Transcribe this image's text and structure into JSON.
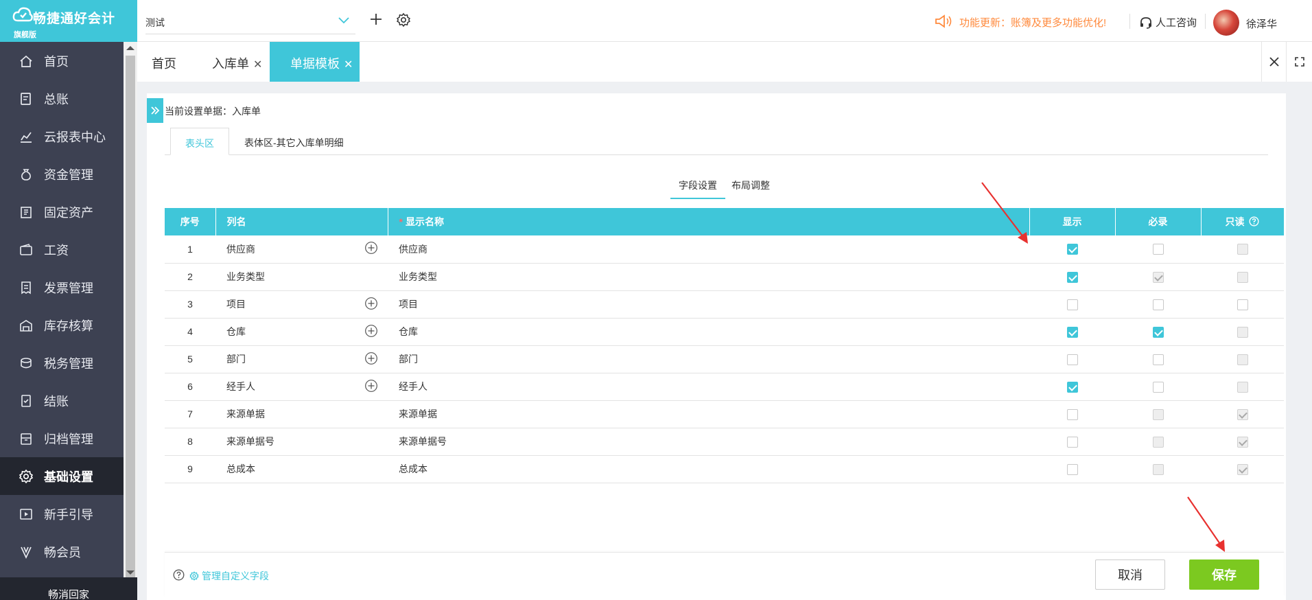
{
  "app": {
    "brand": "畅捷通好会计",
    "edition": "旗舰版"
  },
  "sidebar": {
    "items": [
      {
        "label": "首页",
        "icon": "home-icon"
      },
      {
        "label": "总账",
        "icon": "ledger-icon"
      },
      {
        "label": "云报表中心",
        "icon": "chart-icon"
      },
      {
        "label": "资金管理",
        "icon": "money-bag-icon"
      },
      {
        "label": "固定资产",
        "icon": "asset-icon"
      },
      {
        "label": "工资",
        "icon": "wallet-icon"
      },
      {
        "label": "发票管理",
        "icon": "invoice-icon"
      },
      {
        "label": "库存核算",
        "icon": "warehouse-icon"
      },
      {
        "label": "税务管理",
        "icon": "tax-icon"
      },
      {
        "label": "结账",
        "icon": "checkout-icon"
      },
      {
        "label": "归档管理",
        "icon": "archive-icon"
      },
      {
        "label": "基础设置",
        "icon": "gear-icon",
        "active": true
      },
      {
        "label": "新手引导",
        "icon": "guide-icon"
      },
      {
        "label": "畅会员",
        "icon": "vip-icon"
      }
    ],
    "bottom_label": "畅消回家"
  },
  "topbar": {
    "account_name": "测试",
    "notice": "功能更新：账簿及更多功能优化!",
    "consult": "人工咨询",
    "username": "徐泽华"
  },
  "tabs": [
    {
      "label": "首页",
      "closable": false
    },
    {
      "label": "入库单",
      "closable": true
    },
    {
      "label": "单据模板",
      "closable": true,
      "active": true
    }
  ],
  "panel": {
    "current_doc": "当前设置单据：入库单",
    "sub_tabs": [
      "表头区",
      "表体区-其它入库单明细"
    ],
    "setting_tabs": [
      "字段设置",
      "布局调整"
    ]
  },
  "table": {
    "headers": {
      "seq": "序号",
      "col": "列名",
      "display_name": "显示名称",
      "show": "显示",
      "required": "必录",
      "readonly": "只读"
    },
    "rows": [
      {
        "seq": "1",
        "col": "供应商",
        "name": "供应商",
        "plus": true,
        "show": "on",
        "required": "off",
        "readonly": "dis"
      },
      {
        "seq": "2",
        "col": "业务类型",
        "name": "业务类型",
        "plus": false,
        "show": "on",
        "required": "dis-on",
        "readonly": "dis"
      },
      {
        "seq": "3",
        "col": "项目",
        "name": "项目",
        "plus": true,
        "show": "off",
        "required": "off",
        "readonly": "off"
      },
      {
        "seq": "4",
        "col": "仓库",
        "name": "仓库",
        "plus": true,
        "show": "on",
        "required": "on",
        "readonly": "dis"
      },
      {
        "seq": "5",
        "col": "部门",
        "name": "部门",
        "plus": true,
        "show": "off",
        "required": "off",
        "readonly": "dis"
      },
      {
        "seq": "6",
        "col": "经手人",
        "name": "经手人",
        "plus": true,
        "show": "on",
        "required": "off",
        "readonly": "dis"
      },
      {
        "seq": "7",
        "col": "来源单据",
        "name": "来源单据",
        "plus": false,
        "show": "off",
        "required": "dis",
        "readonly": "dis-on"
      },
      {
        "seq": "8",
        "col": "来源单据号",
        "name": "来源单据号",
        "plus": false,
        "show": "off",
        "required": "dis",
        "readonly": "dis-on"
      },
      {
        "seq": "9",
        "col": "总成本",
        "name": "总成本",
        "plus": false,
        "show": "off",
        "required": "dis",
        "readonly": "dis-on"
      }
    ]
  },
  "footer": {
    "manage_link": "管理自定义字段",
    "cancel": "取消",
    "save": "保存"
  },
  "colors": {
    "accent": "#3fc6d9",
    "sidebar_bg": "#3d4152",
    "save_green": "#7cc920",
    "notice_orange": "#ff8a3d",
    "annotation_red": "#e8312f"
  }
}
